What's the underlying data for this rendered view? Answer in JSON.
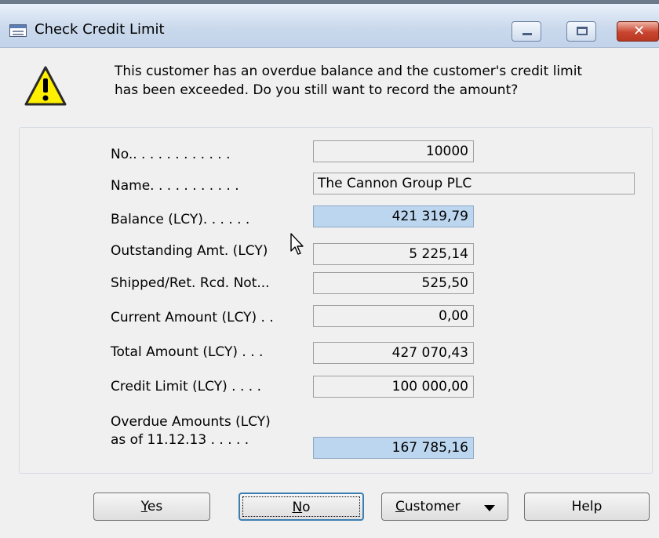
{
  "window": {
    "title": "Check Credit Limit"
  },
  "message": {
    "line1": "This customer has an overdue balance and the customer's credit limit",
    "line2": "has been exceeded. Do you still want to record the amount?"
  },
  "fields": {
    "no": {
      "label": "No.. . . . . . . . . . . .",
      "value": "10000"
    },
    "name": {
      "label": "Name. . . . . . . . . . .",
      "value": "The Cannon Group PLC"
    },
    "balance": {
      "label": "Balance (LCY). . . . . .",
      "value": "421 319,79"
    },
    "outstanding": {
      "label": "Outstanding Amt. (LCY)",
      "value": "5 225,14"
    },
    "shipped": {
      "label": "Shipped/Ret. Rcd. Not...",
      "value": "525,50"
    },
    "current": {
      "label": "Current Amount (LCY) . .",
      "value": "0,00"
    },
    "total": {
      "label": "Total Amount (LCY) . . .",
      "value": "427 070,43"
    },
    "credit_limit": {
      "label": "Credit Limit (LCY) . . . .",
      "value": "100 000,00"
    },
    "overdue": {
      "label_line1": "Overdue Amounts (LCY)",
      "label_line2": "as of 11.12.13 . . . . .",
      "value": "167 785,16"
    }
  },
  "buttons": {
    "yes": {
      "mnemonic": "Y",
      "rest": "es"
    },
    "no": {
      "mnemonic": "N",
      "rest": "o"
    },
    "customer": {
      "mnemonic": "C",
      "rest": "ustomer"
    },
    "help": {
      "label": "Help"
    }
  },
  "colors": {
    "highlight_field": "#bcd6f0",
    "warning": "#ffef00"
  },
  "icons": {
    "window": "dialog-window-icon",
    "warning": "warning-icon",
    "cursor": "mouse-pointer-icon"
  }
}
